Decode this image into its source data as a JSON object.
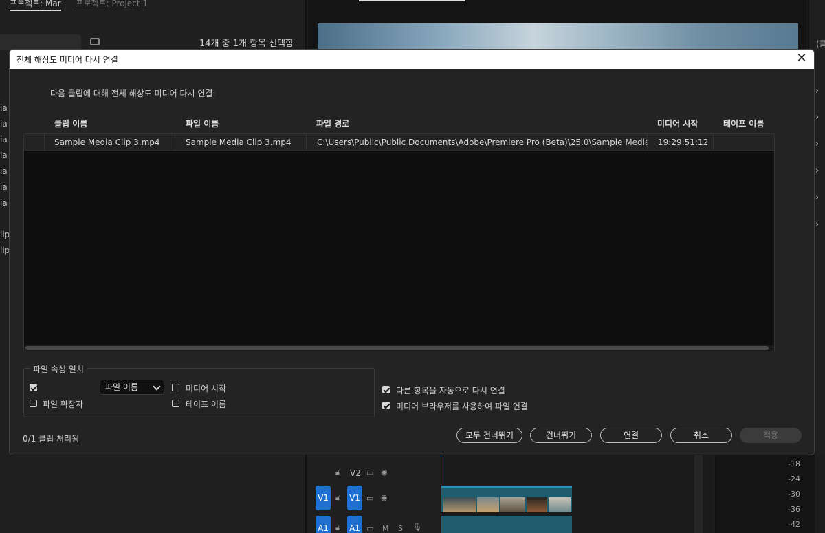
{
  "background": {
    "project_tabs": [
      "프로젝트: Mar",
      "프로젝트: Project 1"
    ],
    "selection_count": "14개 중 1개 항목 선택함",
    "left_list_items": [
      "ia (",
      "ia (",
      "ia (",
      "ia (",
      "ia (",
      "ia (",
      "ia (",
      "",
      "lip",
      "lip"
    ],
    "right_header": "(클",
    "timeline": {
      "tracks": [
        {
          "source": "",
          "label": "V2"
        },
        {
          "source": "V1",
          "label": "V1"
        },
        {
          "source": "A1",
          "label": "A1",
          "m": "M",
          "s": "S"
        }
      ],
      "meter_ticks": [
        "-18",
        "-24",
        "-30",
        "-36",
        "-42"
      ]
    }
  },
  "dialog": {
    "title": "전체 해상도 미디어 다시 연결",
    "intro": "다음 클립에 대해 전체 해상도 미디어 다시 연결:",
    "columns": [
      "클립 이름",
      "파일 이름",
      "파일 경로",
      "미디어 시작",
      "테이프 이름"
    ],
    "rows": [
      {
        "clip_name": "Sample Media Clip 3.mp4",
        "file_name": "Sample Media Clip 3.mp4",
        "file_path": "C:\\Users\\Public\\Public Documents\\Adobe\\Premiere Pro (Beta)\\25.0\\Sample Media",
        "media_start": "19:29:51:12",
        "tape_name": ""
      }
    ],
    "match_group": {
      "legend": "파일 속성 일치",
      "first_checked": true,
      "select_value": "파일 이름",
      "media_start_label": "미디어 시작",
      "media_start_checked": false,
      "extension_label": "파일 확장자",
      "extension_checked": false,
      "tape_name_label": "테이프 이름",
      "tape_name_checked": false
    },
    "options": {
      "auto_relink_label": "다른 항목을 자동으로 다시 연결",
      "auto_relink_checked": true,
      "media_browser_label": "미디어 브라우저를 사용하여 파일 연결",
      "media_browser_checked": true
    },
    "status": "0/1 클립 처리됨",
    "buttons": {
      "skip_all": "모두 건너뛰기",
      "skip": "건너뛰기",
      "connect": "연결",
      "cancel": "취소",
      "apply": "적용"
    }
  }
}
